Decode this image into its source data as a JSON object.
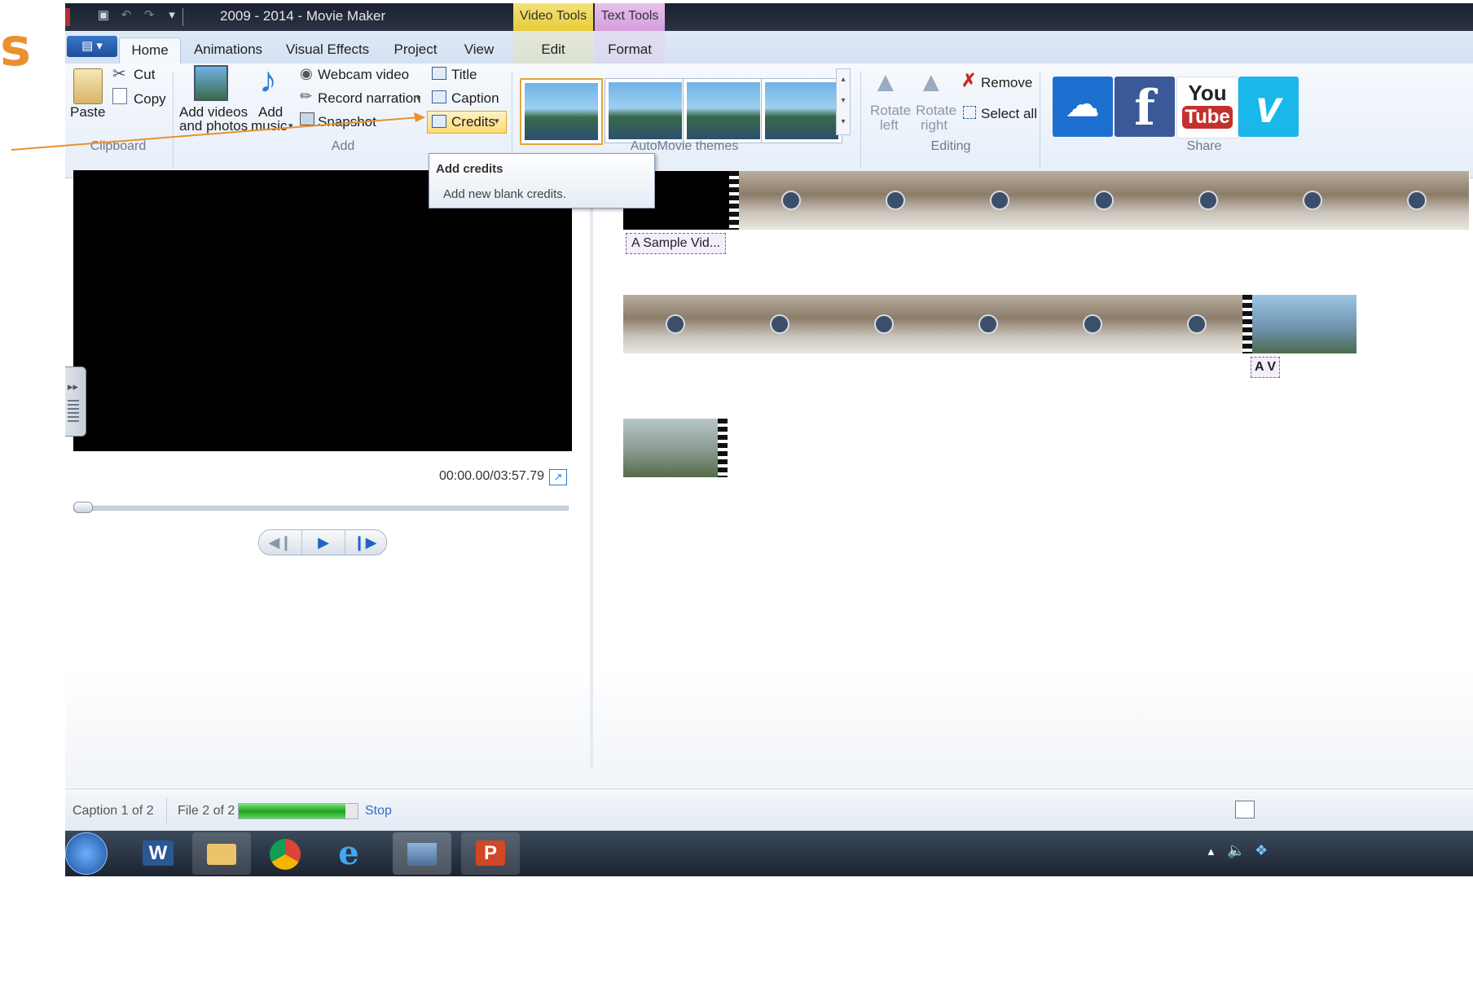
{
  "slide": {
    "letter": "s"
  },
  "window": {
    "title": "2009 - 2014 - Movie Maker"
  },
  "context_tabs": {
    "video_tools": "Video Tools",
    "text_tools": "Text Tools"
  },
  "tabs": [
    {
      "label": "Home"
    },
    {
      "label": "Animations"
    },
    {
      "label": "Visual Effects"
    },
    {
      "label": "Project"
    },
    {
      "label": "View"
    },
    {
      "label": "Edit"
    },
    {
      "label": "Format"
    }
  ],
  "ribbon": {
    "clipboard": {
      "paste": "Paste",
      "cut": "Cut",
      "copy": "Copy",
      "group": "Clipboard"
    },
    "add": {
      "add_videos_line1": "Add videos",
      "add_videos_line2": "and photos",
      "add_music_line1": "Add",
      "add_music_line2": "music",
      "webcam": "Webcam video",
      "narration": "Record narration",
      "snapshot": "Snapshot",
      "title": "Title",
      "caption": "Caption",
      "credits": "Credits",
      "group": "Add"
    },
    "themes": {
      "group": "AutoMovie themes"
    },
    "editing": {
      "rotate_left_1": "Rotate",
      "rotate_left_2": "left",
      "rotate_right_1": "Rotate",
      "rotate_right_2": "right",
      "remove": "Remove",
      "select_all": "Select all",
      "group": "Editing"
    },
    "share": {
      "group": "Share",
      "youtube_1": "You",
      "youtube_2": "Tube",
      "facebook": "f",
      "vimeo": "v"
    }
  },
  "tooltip": {
    "title": "Add credits",
    "body": "Add new blank credits."
  },
  "player": {
    "timecode": "00:00.00/03:57.79"
  },
  "storyboard": {
    "caption1": "A Sample Vid...",
    "caption2": "A V"
  },
  "status": {
    "caption": "Caption 1 of 2",
    "file": "File 2 of 2",
    "stop": "Stop",
    "progress": 0.9
  },
  "taskbar": {
    "word": "W",
    "powerpoint": "P"
  },
  "colors": {
    "accent": "#e8912d",
    "ribbon_bg": "#e6eef8",
    "taskbar": "#1c2330"
  }
}
